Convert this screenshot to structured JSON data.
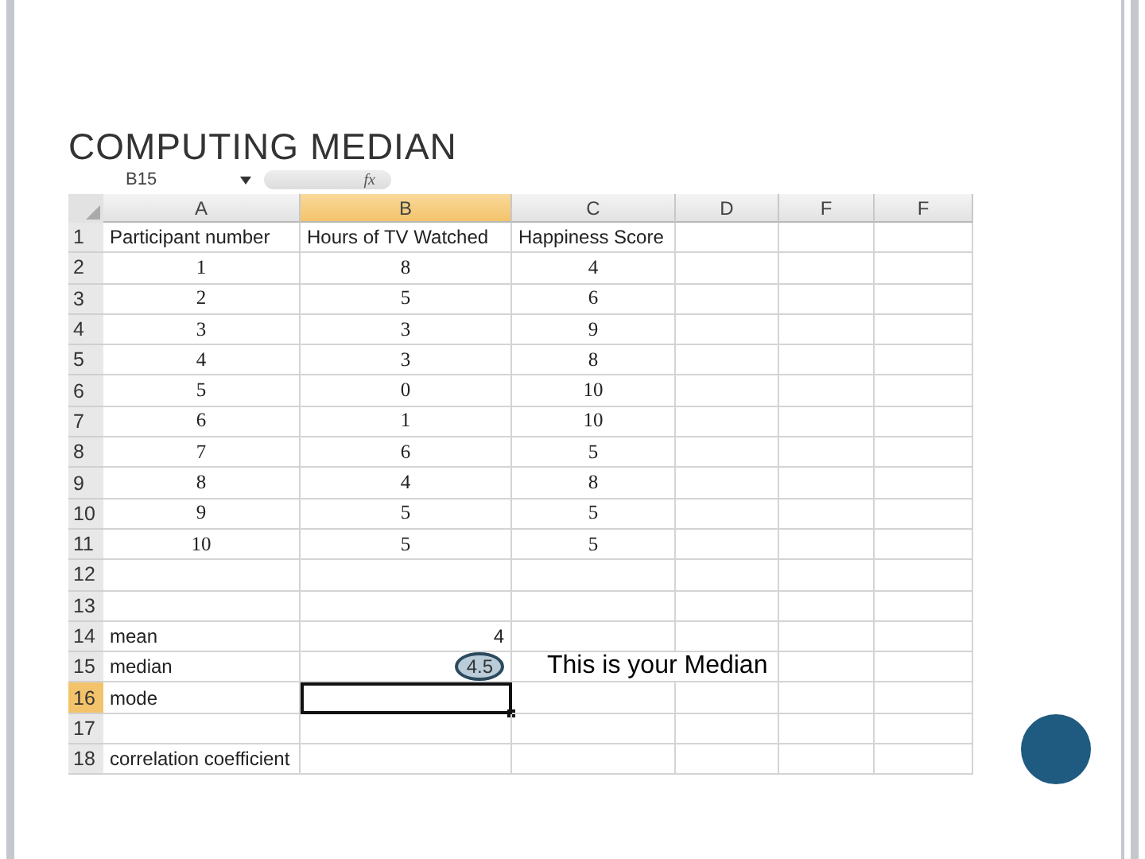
{
  "slide": {
    "title": "COMPUTING MEDIAN"
  },
  "formula_bar": {
    "name_box": "B15",
    "function_label": "fx"
  },
  "columns": [
    {
      "label": "A",
      "selected": false
    },
    {
      "label": "B",
      "selected": true
    },
    {
      "label": "C",
      "selected": false
    },
    {
      "label": "D",
      "selected": false
    },
    {
      "label": "F",
      "selected": false
    },
    {
      "label": "F",
      "selected": false
    }
  ],
  "rows": [
    {
      "number": "1",
      "selected": false,
      "cells": [
        {
          "text": "Participant number",
          "kind": "label"
        },
        {
          "text": "Hours of TV Watched",
          "kind": "label"
        },
        {
          "text": "Happiness Score",
          "kind": "label"
        }
      ]
    },
    {
      "number": "2",
      "selected": false,
      "cells": [
        {
          "text": "1",
          "kind": "centered"
        },
        {
          "text": "8",
          "kind": "centered"
        },
        {
          "text": "4",
          "kind": "centered"
        }
      ]
    },
    {
      "number": "3",
      "selected": false,
      "cells": [
        {
          "text": "2",
          "kind": "centered"
        },
        {
          "text": "5",
          "kind": "centered"
        },
        {
          "text": "6",
          "kind": "centered"
        }
      ]
    },
    {
      "number": "4",
      "selected": false,
      "cells": [
        {
          "text": "3",
          "kind": "centered"
        },
        {
          "text": "3",
          "kind": "centered"
        },
        {
          "text": "9",
          "kind": "centered"
        }
      ]
    },
    {
      "number": "5",
      "selected": false,
      "cells": [
        {
          "text": "4",
          "kind": "centered"
        },
        {
          "text": "3",
          "kind": "centered"
        },
        {
          "text": "8",
          "kind": "centered"
        }
      ]
    },
    {
      "number": "6",
      "selected": false,
      "cells": [
        {
          "text": "5",
          "kind": "centered"
        },
        {
          "text": "0",
          "kind": "centered"
        },
        {
          "text": "10",
          "kind": "centered"
        }
      ]
    },
    {
      "number": "7",
      "selected": false,
      "cells": [
        {
          "text": "6",
          "kind": "centered"
        },
        {
          "text": "1",
          "kind": "centered"
        },
        {
          "text": "10",
          "kind": "centered"
        }
      ]
    },
    {
      "number": "8",
      "selected": false,
      "cells": [
        {
          "text": "7",
          "kind": "centered"
        },
        {
          "text": "6",
          "kind": "centered"
        },
        {
          "text": "5",
          "kind": "centered"
        }
      ]
    },
    {
      "number": "9",
      "selected": false,
      "cells": [
        {
          "text": "8",
          "kind": "centered"
        },
        {
          "text": "4",
          "kind": "centered"
        },
        {
          "text": "8",
          "kind": "centered"
        }
      ]
    },
    {
      "number": "10",
      "selected": false,
      "cells": [
        {
          "text": "9",
          "kind": "centered"
        },
        {
          "text": "5",
          "kind": "centered"
        },
        {
          "text": "5",
          "kind": "centered"
        }
      ]
    },
    {
      "number": "11",
      "selected": false,
      "cells": [
        {
          "text": "10",
          "kind": "centered"
        },
        {
          "text": "5",
          "kind": "centered"
        },
        {
          "text": "5",
          "kind": "centered"
        }
      ]
    },
    {
      "number": "12",
      "selected": false,
      "cells": []
    },
    {
      "number": "13",
      "selected": false,
      "cells": []
    },
    {
      "number": "14",
      "selected": false,
      "cells": [
        {
          "text": "mean",
          "kind": "label"
        },
        {
          "text": "4",
          "kind": "result"
        }
      ]
    },
    {
      "number": "15",
      "selected": false,
      "cells": [
        {
          "text": "median",
          "kind": "label"
        },
        {
          "text": "4.5",
          "kind": "result",
          "circled": true
        }
      ],
      "note": "This is your Median"
    },
    {
      "number": "16",
      "selected": true,
      "cells": [
        {
          "text": "mode",
          "kind": "label"
        },
        {
          "text": "",
          "kind": "active"
        }
      ]
    },
    {
      "number": "17",
      "selected": false,
      "cells": []
    },
    {
      "number": "18",
      "selected": false,
      "cells": [
        {
          "text": "correlation coefficient",
          "kind": "label"
        }
      ]
    }
  ]
}
